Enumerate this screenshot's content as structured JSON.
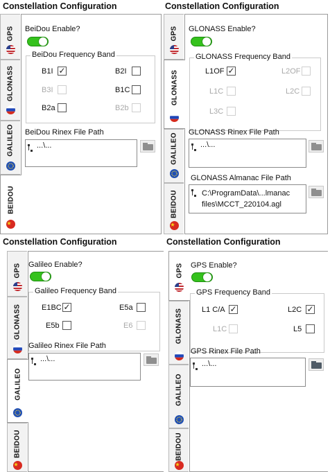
{
  "panels": [
    {
      "title": "Constellation Configuration",
      "tabs": [
        "GPS",
        "GLONASS",
        "GALILEO",
        "BEIDOU"
      ],
      "active_tab": "BEIDOU",
      "enable_label": "BeiDou Enable?",
      "enabled": true,
      "band_title": "BeiDou Frequency Band",
      "options": [
        {
          "label": "B1I",
          "checked": true,
          "enabled": true
        },
        {
          "label": "B2I",
          "checked": false,
          "enabled": true
        },
        {
          "label": "B3I",
          "checked": false,
          "enabled": false
        },
        {
          "label": "B1C",
          "checked": false,
          "enabled": true
        },
        {
          "label": "B2a",
          "checked": false,
          "enabled": true
        },
        {
          "label": "B2b",
          "checked": false,
          "enabled": false
        }
      ],
      "rinex_label": "BeiDou Rinex File Path",
      "rinex_value": "...\\...",
      "folder_icon": "folder-icon"
    },
    {
      "title": "Constellation Configuration",
      "tabs": [
        "GPS",
        "GLONASS",
        "GALILEO",
        "BEIDOU"
      ],
      "active_tab": "GLONASS",
      "enable_label": "GLONASS Enable?",
      "enabled": true,
      "band_title": "GLONASS Frequency Band",
      "options": [
        {
          "label": "L1OF",
          "checked": true,
          "enabled": true
        },
        {
          "label": "L2OF",
          "checked": false,
          "enabled": false
        },
        {
          "label": "L1C",
          "checked": false,
          "enabled": false
        },
        {
          "label": "L2C",
          "checked": false,
          "enabled": false
        },
        {
          "label": "L3C",
          "checked": false,
          "enabled": false
        }
      ],
      "rinex_label": "GLONASS Rinex File Path",
      "rinex_value": "...\\...",
      "almanac_label": "GLONASS Almanac File Path",
      "almanac_line1": "C:\\ProgramData\\...lmanac",
      "almanac_line2": "files\\MCCT_220104.agl",
      "folder_icon": "folder-icon"
    },
    {
      "title": "Constellation Configuration",
      "tabs": [
        "GPS",
        "GLONASS",
        "GALILEO",
        "BEIDOU"
      ],
      "active_tab": "GALILEO",
      "enable_label": "Galileo Enable?",
      "enabled": true,
      "band_title": "Galileo Frequency Band",
      "options": [
        {
          "label": "E1BC",
          "checked": true,
          "enabled": true
        },
        {
          "label": "E5a",
          "checked": false,
          "enabled": true
        },
        {
          "label": "E5b",
          "checked": false,
          "enabled": true
        },
        {
          "label": "E6",
          "checked": false,
          "enabled": false
        }
      ],
      "rinex_label": "Galileo Rinex File Path",
      "rinex_value": "...\\...",
      "folder_icon": "folder-icon"
    },
    {
      "title": "Constellation Configuration",
      "tabs": [
        "GPS",
        "GLONASS",
        "GALILEO",
        "BEIDOU"
      ],
      "active_tab": "GPS",
      "enable_label": "GPS Enable?",
      "enabled": true,
      "band_title": "GPS Frequency Band",
      "options": [
        {
          "label": "L1 C/A",
          "checked": true,
          "enabled": true
        },
        {
          "label": "L2C",
          "checked": true,
          "enabled": true
        },
        {
          "label": "L1C",
          "checked": false,
          "enabled": false
        },
        {
          "label": "L5",
          "checked": false,
          "enabled": true
        }
      ],
      "rinex_label": "GPS Rinex File Path",
      "rinex_value": "...\\...",
      "folder_icon": "folder-icon"
    }
  ],
  "flags": {
    "GPS": "us-flag-icon",
    "GLONASS": "russia-flag-icon",
    "GALILEO": "eu-flag-icon",
    "BEIDOU": "china-flag-icon"
  },
  "colors": {
    "toggle_on": "#35c21d",
    "checkmark": "#222222",
    "disabled_text": "#a9a9a9"
  }
}
